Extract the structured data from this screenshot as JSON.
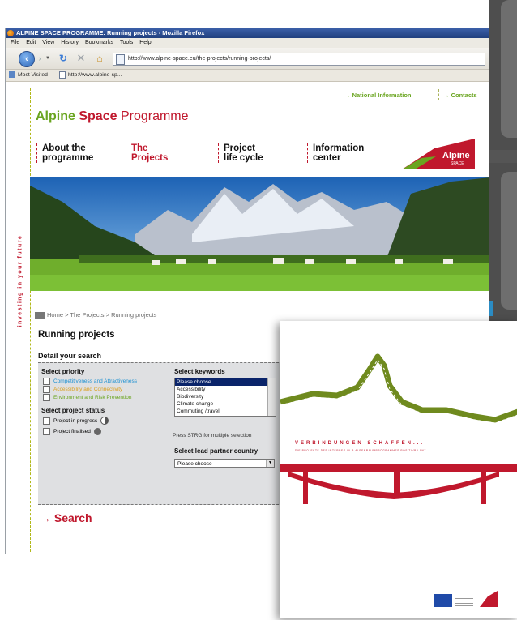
{
  "browser": {
    "title": "ALPINE SPACE PROGRAMME: Running projects - Mozilla Firefox",
    "menu": [
      "File",
      "Edit",
      "View",
      "History",
      "Bookmarks",
      "Tools",
      "Help"
    ],
    "url": "http://www.alpine-space.eu/the-projects/running-projects/",
    "bookmarks": [
      {
        "label": "Most Visited",
        "icon": "bookmarks-icon"
      },
      {
        "label": "http://www.alpine-sp...",
        "icon": "page-icon"
      }
    ]
  },
  "site": {
    "top_links": [
      "National Information",
      "Contacts"
    ],
    "logo": {
      "part1": "Alpine ",
      "part2": "Space ",
      "part3": "Programme"
    },
    "tagline": "investing in your future",
    "nav": [
      {
        "line1": "About the",
        "line2": "programme"
      },
      {
        "line1": "The",
        "line2": "Projects"
      },
      {
        "line1": "Project",
        "line2": "life cycle"
      },
      {
        "line1": "Information",
        "line2": "center"
      }
    ],
    "brand_badge": {
      "word1": "Alpine",
      "word2": "SPACE"
    },
    "breadcrumb": "Home > The Projects > Running projects",
    "page_title": "Running projects",
    "detail_heading": "Detail your search",
    "priority": {
      "heading": "Select priority",
      "options": [
        {
          "label": "Competitiveness and Attractiveness",
          "color": "#1a8fd1"
        },
        {
          "label": "Accessibility and Connectivity",
          "color": "#d9a020"
        },
        {
          "label": "Environment and Risk Prevention",
          "color": "#6aa520"
        }
      ]
    },
    "status": {
      "heading": "Select project status",
      "options": [
        "Project in progress",
        "Project finalised"
      ]
    },
    "keywords": {
      "heading": "Select keywords",
      "options": [
        "Please choose",
        "Accessibility",
        "Biodiversity",
        "Climate change",
        "Commuting /travel"
      ],
      "hint": "Press STRG for multiple selection"
    },
    "country": {
      "heading": "Select lead partner country",
      "value": "Please choose"
    },
    "search_label": "Search",
    "arrow": "→"
  },
  "brochure": {
    "title": "VERBINDUNGEN SCHAFFEN...",
    "subtitle": "DIE PROJEKTE DES INTERREG III B ALPENRAUMPROGRAMMES POSITIVBILANZ"
  },
  "colors": {
    "brand_green": "#6aa520",
    "brand_red": "#c0182d"
  }
}
